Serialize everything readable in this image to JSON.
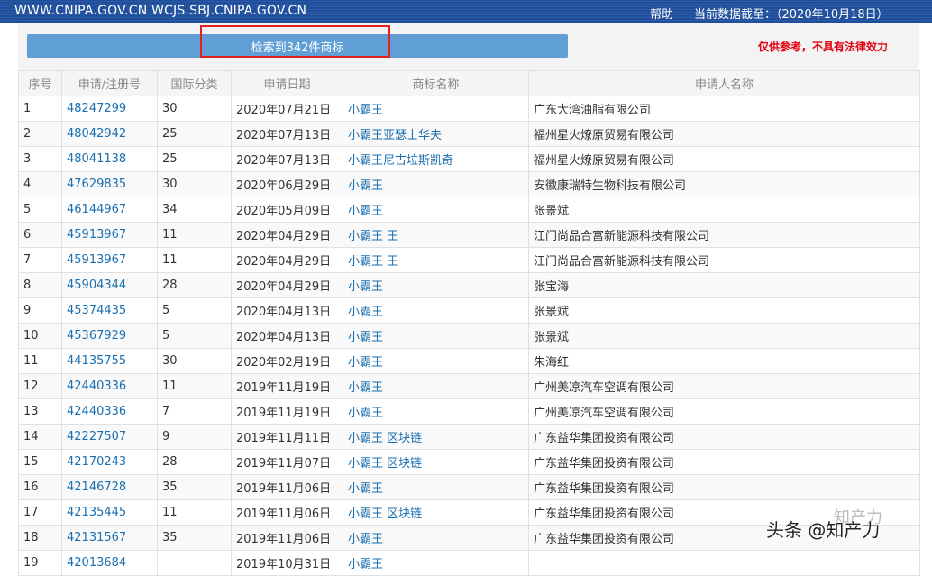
{
  "header": {
    "site_url": "WWW.CNIPA.GOV.CN WCJS.SBJ.CNIPA.GOV.CN",
    "help": "帮助",
    "data_date": "当前数据截至：（2020年10月18日）"
  },
  "summary": {
    "result_text": "检索到342件商标",
    "disclaimer": "仅供参考，不具有法律效力"
  },
  "table": {
    "columns": [
      "序号",
      "申请/注册号",
      "国际分类",
      "申请日期",
      "商标名称",
      "申请人名称"
    ],
    "rows": [
      {
        "seq": "1",
        "reg_no": "48247299",
        "class": "30",
        "date": "2020年07月21日",
        "name": "小霸王",
        "applicant": "广东大湾油脂有限公司"
      },
      {
        "seq": "2",
        "reg_no": "48042942",
        "class": "25",
        "date": "2020年07月13日",
        "name": "小霸王亚瑟士华夫",
        "applicant": "福州星火燎原贸易有限公司"
      },
      {
        "seq": "3",
        "reg_no": "48041138",
        "class": "25",
        "date": "2020年07月13日",
        "name": "小霸王尼古垃斯凯奇",
        "applicant": "福州星火燎原贸易有限公司"
      },
      {
        "seq": "4",
        "reg_no": "47629835",
        "class": "30",
        "date": "2020年06月29日",
        "name": "小霸王",
        "applicant": "安徽康瑞特生物科技有限公司"
      },
      {
        "seq": "5",
        "reg_no": "46144967",
        "class": "34",
        "date": "2020年05月09日",
        "name": "小霸王",
        "applicant": "张景斌"
      },
      {
        "seq": "6",
        "reg_no": "45913967",
        "class": "11",
        "date": "2020年04月29日",
        "name": "小霸王 王",
        "applicant": "江门尚品合富新能源科技有限公司"
      },
      {
        "seq": "7",
        "reg_no": "45913967",
        "class": "11",
        "date": "2020年04月29日",
        "name": "小霸王 王",
        "applicant": "江门尚品合富新能源科技有限公司"
      },
      {
        "seq": "8",
        "reg_no": "45904344",
        "class": "28",
        "date": "2020年04月29日",
        "name": "小霸王",
        "applicant": "张宝海"
      },
      {
        "seq": "9",
        "reg_no": "45374435",
        "class": "5",
        "date": "2020年04月13日",
        "name": "小霸王",
        "applicant": "张景斌"
      },
      {
        "seq": "10",
        "reg_no": "45367929",
        "class": "5",
        "date": "2020年04月13日",
        "name": "小霸王",
        "applicant": "张景斌"
      },
      {
        "seq": "11",
        "reg_no": "44135755",
        "class": "30",
        "date": "2020年02月19日",
        "name": "小霸王",
        "applicant": "朱海红"
      },
      {
        "seq": "12",
        "reg_no": "42440336",
        "class": "11",
        "date": "2019年11月19日",
        "name": "小霸王",
        "applicant": "广州美凉汽车空调有限公司"
      },
      {
        "seq": "13",
        "reg_no": "42440336",
        "class": "7",
        "date": "2019年11月19日",
        "name": "小霸王",
        "applicant": "广州美凉汽车空调有限公司"
      },
      {
        "seq": "14",
        "reg_no": "42227507",
        "class": "9",
        "date": "2019年11月11日",
        "name": "小霸王 区块链",
        "applicant": "广东益华集团投资有限公司"
      },
      {
        "seq": "15",
        "reg_no": "42170243",
        "class": "28",
        "date": "2019年11月07日",
        "name": "小霸王 区块链",
        "applicant": "广东益华集团投资有限公司"
      },
      {
        "seq": "16",
        "reg_no": "42146728",
        "class": "35",
        "date": "2019年11月06日",
        "name": "小霸王",
        "applicant": "广东益华集团投资有限公司"
      },
      {
        "seq": "17",
        "reg_no": "42135445",
        "class": "11",
        "date": "2019年11月06日",
        "name": "小霸王 区块链",
        "applicant": "广东益华集团投资有限公司"
      },
      {
        "seq": "18",
        "reg_no": "42131567",
        "class": "35",
        "date": "2019年11月06日",
        "name": "小霸王",
        "applicant": "广东益华集团投资有限公司"
      },
      {
        "seq": "19",
        "reg_no": "42013684",
        "class": "",
        "date": "2019年10月31日",
        "name": "小霸王",
        "applicant": ""
      }
    ]
  },
  "watermark": {
    "text": "头条 @知产力",
    "faint_text": "知产力"
  }
}
